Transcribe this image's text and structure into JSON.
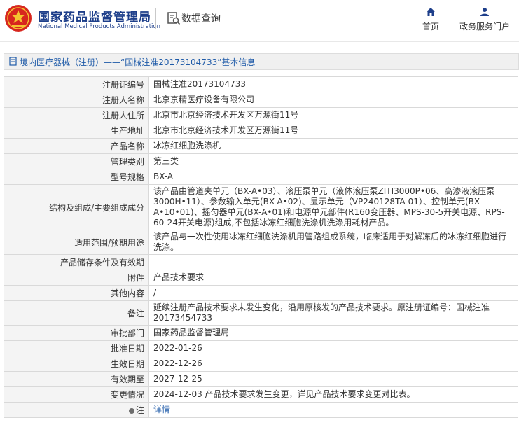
{
  "header": {
    "brand_cn": "国家药品监督管理局",
    "brand_en": "National Medical Products Administration",
    "section_title": "数据查询",
    "nav": {
      "home": "首页",
      "portal": "政务服务门户"
    }
  },
  "breadcrumb": {
    "link": "境内医疗器械（注册）",
    "rest": "——“国械注准20173104733”基本信息"
  },
  "rows": [
    {
      "label": "注册证编号",
      "value": "国械注准20173104733"
    },
    {
      "label": "注册人名称",
      "value": "北京京精医疗设备有限公司"
    },
    {
      "label": "注册人住所",
      "value": "北京市北京经济技术开发区万源街11号"
    },
    {
      "label": "生产地址",
      "value": "北京市北京经济技术开发区万源街11号"
    },
    {
      "label": "产品名称",
      "value": "冰冻红细胞洗涤机"
    },
    {
      "label": "管理类别",
      "value": "第三类"
    },
    {
      "label": "型号规格",
      "value": "BX-A"
    },
    {
      "label": "结构及组成/主要组成成分",
      "value": "该产品由管道夹单元（BX-A•03）、滚压泵单元（液体滚压泵ZITI3000P•06、高渗液滚压泵3000H•11）、参数输入单元(BX-A•02)、显示单元（VP240128TA-01）、控制单元(BX-A•10•01)、摇匀器单元(BX-A•01)和电源单元部件(R160变压器、MPS-30-5开关电源、RPS-60-24开关电源)组成,不包括冰冻红细胞洗涤机洗涤用耗材产品。"
    },
    {
      "label": "适用范围/预期用途",
      "value": "该产品与一次性使用冰冻红细胞洗涤机用管路组成系统，临床适用于对解冻后的冰冻红细胞进行洗涤。"
    },
    {
      "label": "产品储存条件及有效期",
      "value": ""
    },
    {
      "label": "附件",
      "value": "产品技术要求"
    },
    {
      "label": "其他内容",
      "value": "/"
    },
    {
      "label": "备注",
      "value": "延续注册产品技术要求未发生变化，沿用原核发的产品技术要求。原注册证编号：国械注准20173454733"
    },
    {
      "label": "审批部门",
      "value": "国家药品监督管理局"
    },
    {
      "label": "批准日期",
      "value": "2022-01-26"
    },
    {
      "label": "生效日期",
      "value": "2022-12-26"
    },
    {
      "label": "有效期至",
      "value": "2027-12-25"
    },
    {
      "label": "变更情况",
      "value": "2024-12-03 产品技术要求发生变更，详见产品技术要求变更对比表。"
    },
    {
      "label": "注",
      "value": "详情"
    }
  ],
  "colors": {
    "brand": "#1d3e8a",
    "link": "#1e5aa8",
    "logo_red": "#d7261e"
  },
  "icons": [
    "emblem-logo",
    "data-query-icon",
    "home-icon",
    "user-icon",
    "document-icon",
    "note-icon"
  ]
}
